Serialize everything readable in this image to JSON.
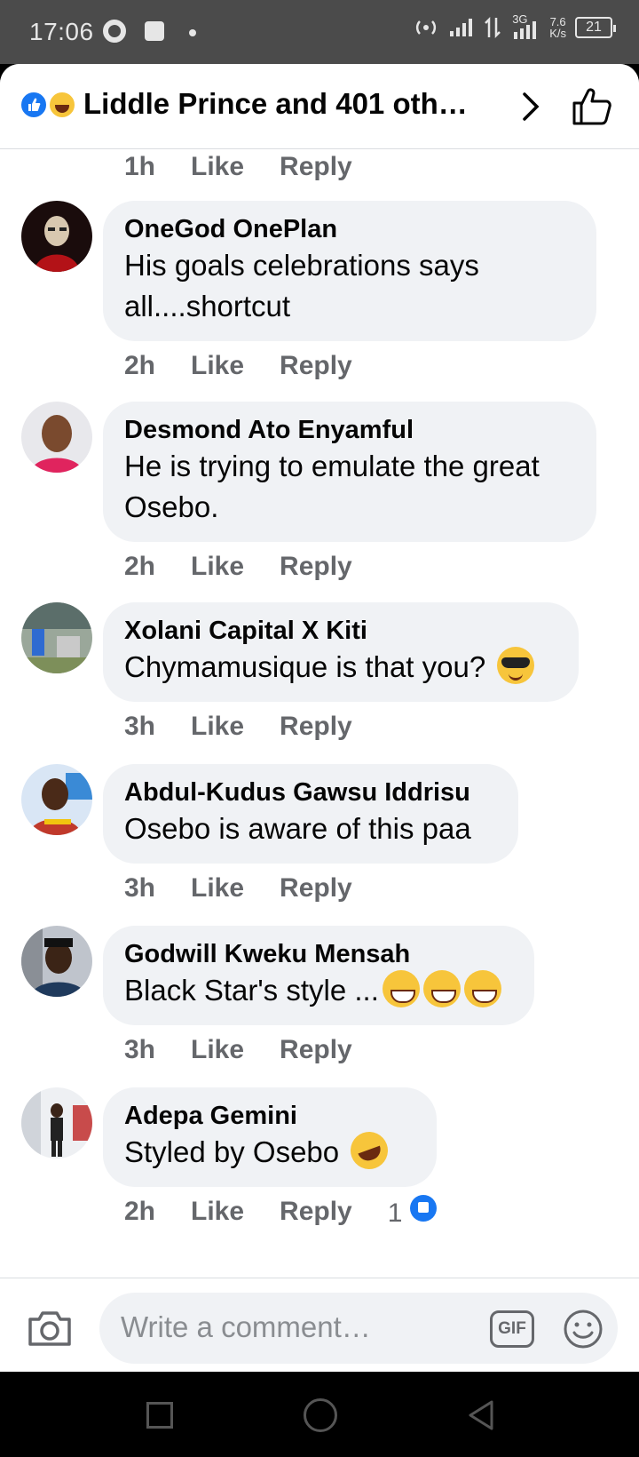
{
  "status_bar": {
    "time": "17:06",
    "network": "3G",
    "speed_value": "7.6",
    "speed_unit": "K/s",
    "battery": "21"
  },
  "header": {
    "title": "Liddle Prince and 401 oth…",
    "reactions": [
      "like-icon",
      "haha-icon"
    ]
  },
  "first_meta": {
    "time": "1h",
    "like": "Like",
    "reply": "Reply"
  },
  "comments": [
    {
      "name": "OneGod OnePlan",
      "text": "His goals celebrations says all....shortcut",
      "time": "2h",
      "like": "Like",
      "reply": "Reply"
    },
    {
      "name": "Desmond Ato Enyamful",
      "text": "He is trying to emulate the great Osebo.",
      "time": "2h",
      "like": "Like",
      "reply": "Reply"
    },
    {
      "name": "Xolani Capital X Kiti",
      "text": "Chymamusique is that you?",
      "emoji": "sunglasses-emoji",
      "time": "3h",
      "like": "Like",
      "reply": "Reply"
    },
    {
      "name": "Abdul-Kudus Gawsu Iddrisu",
      "text": "Osebo is aware of this paa",
      "time": "3h",
      "like": "Like",
      "reply": "Reply"
    },
    {
      "name": "Godwill Kweku Mensah",
      "text": "Black Star's style ...",
      "emoji": "grin-emoji x3",
      "time": "3h",
      "like": "Like",
      "reply": "Reply"
    },
    {
      "name": "Adepa Gemini",
      "text": "Styled by Osebo",
      "emoji": "rofl-emoji",
      "time": "2h",
      "like": "Like",
      "reply": "Reply",
      "like_count": "1"
    }
  ],
  "composer": {
    "placeholder": "Write a comment…",
    "gif_label": "GIF"
  },
  "colors": {
    "facebook_blue": "#1877f2",
    "bubble_bg": "#f0f2f5",
    "meta_gray": "#65676b",
    "status_bar": "#4b4b4b"
  }
}
